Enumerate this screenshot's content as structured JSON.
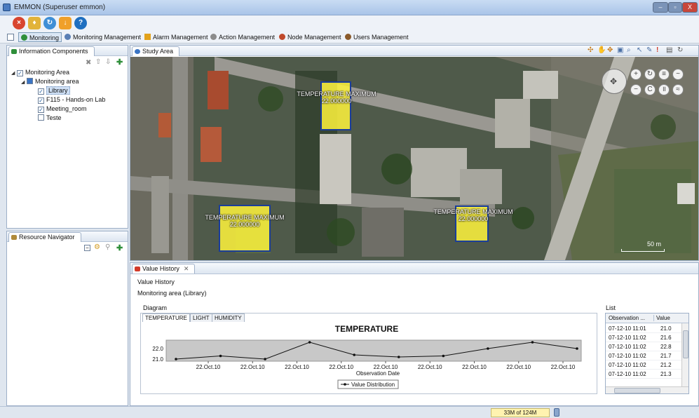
{
  "window": {
    "title": "EMMON (Superuser emmon)",
    "minimize": "–",
    "maximize": "▫",
    "close": "X"
  },
  "toolbar": {
    "buttons": [
      {
        "icon": "exit-icon"
      },
      {
        "icon": "user-icon"
      },
      {
        "icon": "refresh-icon"
      },
      {
        "icon": "save-icon"
      },
      {
        "icon": "help-icon",
        "glyph": "?"
      }
    ]
  },
  "menu": {
    "items": [
      {
        "label": "Monitoring",
        "icon": "globe-icon",
        "color": "#2f8f3a"
      },
      {
        "label": "Monitoring Management",
        "icon": "gear-icon",
        "color": "#5a7fb5"
      },
      {
        "label": "Alarm Management",
        "icon": "warning-icon",
        "color": "#e2a21b"
      },
      {
        "label": "Action Management",
        "icon": "wrench-icon",
        "color": "#8c8c8c"
      },
      {
        "label": "Node Management",
        "icon": "node-icon",
        "color": "#c0492b"
      },
      {
        "label": "Users Management",
        "icon": "users-icon",
        "color": "#8a5a2b"
      }
    ]
  },
  "info_panel": {
    "title": "Information Components",
    "tree": [
      {
        "label": "Monitoring Area",
        "level": 0,
        "checked": true,
        "expanded": true
      },
      {
        "label": "Monitoring area",
        "level": 1,
        "checked": true,
        "expanded": true
      },
      {
        "label": "Library",
        "level": 2,
        "checked": true,
        "selected": true
      },
      {
        "label": "F115 - Hands-on Lab",
        "level": 2,
        "checked": true
      },
      {
        "label": "Meeting_room",
        "level": 2,
        "checked": true
      },
      {
        "label": "Teste",
        "level": 2,
        "checked": false
      }
    ]
  },
  "resource_panel": {
    "title": "Resource Navigator"
  },
  "study_area": {
    "title": "Study Area",
    "zones": [
      {
        "label": "TEMPERATURE MAXIMUM",
        "value": "22.000000"
      },
      {
        "label": "TEMPERATURE MAXIMUM",
        "value": "22.000000"
      },
      {
        "label": "TEMPERATURE MAXIMUM",
        "value": "22.000000"
      }
    ],
    "scale": "50 m"
  },
  "value_history": {
    "tab": "Value History",
    "heading": "Value History",
    "subheading": "Monitoring area (Library)",
    "diagram_label": "Diagram",
    "list_label": "List",
    "tabs": [
      "TEMPERATURE",
      "LIGHT",
      "HUMIDITY"
    ],
    "list_headers": [
      "Observation ...",
      "Value"
    ],
    "list_rows": [
      [
        "07-12-10 11:01",
        "21.0"
      ],
      [
        "07-12-10 11:02",
        "21.6"
      ],
      [
        "07-12-10 11:02",
        "22.8"
      ],
      [
        "07-12-10 11:02",
        "21.7"
      ],
      [
        "07-12-10 11:02",
        "21.2"
      ],
      [
        "07-12-10 11:02",
        "21.3"
      ]
    ]
  },
  "status": {
    "memory": "33M of 124M"
  },
  "chart_data": {
    "type": "line",
    "title": "TEMPERATURE",
    "xlabel": "Observation Date",
    "ylabel": "",
    "ylim": [
      20.8,
      22.8
    ],
    "yticks": [
      "21.0",
      "22.0"
    ],
    "categories": [
      "22.Oct.10",
      "22.Oct.10",
      "22.Oct.10",
      "22.Oct.10",
      "22.Oct.10",
      "22.Oct.10",
      "22.Oct.10",
      "22.Oct.10",
      "22.Oct.10"
    ],
    "series": [
      {
        "name": "Value Distribution",
        "values": [
          21.0,
          21.3,
          21.0,
          22.6,
          21.4,
          21.2,
          21.3,
          22.0,
          22.6,
          22.0
        ]
      }
    ],
    "legend": "bottom-center",
    "grid": false
  }
}
